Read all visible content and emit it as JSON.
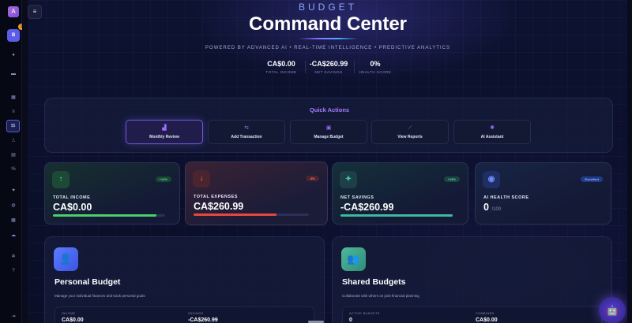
{
  "sidebar": {
    "logo_glyph": "A",
    "avatar_initial": "B",
    "notification_count": "1",
    "icons": [
      {
        "name": "home-icon",
        "glyph": "●"
      },
      {
        "name": "wallet-icon",
        "glyph": "▬"
      },
      {
        "name": "calendar-icon",
        "glyph": "▦"
      },
      {
        "name": "list-icon",
        "glyph": "≡"
      },
      {
        "name": "chart-icon",
        "glyph": "⎍"
      },
      {
        "name": "target-icon",
        "glyph": "◎"
      },
      {
        "name": "document-icon",
        "glyph": "▤"
      },
      {
        "name": "percent-icon",
        "glyph": "%"
      },
      {
        "name": "heart-icon",
        "glyph": "♥"
      },
      {
        "name": "globe-icon",
        "glyph": "◍"
      },
      {
        "name": "grid-icon",
        "glyph": "▦"
      },
      {
        "name": "cloud-icon",
        "glyph": "☁"
      },
      {
        "name": "gear-icon",
        "glyph": "✲"
      },
      {
        "name": "help-icon",
        "glyph": "?"
      },
      {
        "name": "logout-icon",
        "glyph": "⇥"
      }
    ],
    "active_label": "$$"
  },
  "hero": {
    "kicker": "BUDGET",
    "title": "Command Center",
    "subtitle": "POWERED BY ADVANCED AI • REAL-TIME INTELLIGENCE • PREDICTIVE ANALYTICS",
    "stats": [
      {
        "value": "CA$0.00",
        "label": "TOTAL INCOME"
      },
      {
        "value": "-CA$260.99",
        "label": "NET SAVINGS"
      },
      {
        "value": "0%",
        "label": "HEALTH SCORE"
      }
    ]
  },
  "quick_actions": {
    "title": "Quick Actions",
    "buttons": [
      {
        "label": "Monthly Review",
        "icon": "bar-chart-icon",
        "glyph": "▟"
      },
      {
        "label": "Add Transaction",
        "icon": "swap-icon",
        "glyph": "⇆"
      },
      {
        "label": "Manage Budget",
        "icon": "wallet-icon",
        "glyph": "▣"
      },
      {
        "label": "View Reports",
        "icon": "line-chart-icon",
        "glyph": "⟋"
      },
      {
        "label": "AI Assistant",
        "icon": "brain-icon",
        "glyph": "✺"
      }
    ]
  },
  "cards": {
    "income": {
      "label": "TOTAL INCOME",
      "value": "CA$0.00",
      "badge": "+12%",
      "icon_glyph": "↑",
      "progress": 0.92
    },
    "expenses": {
      "label": "TOTAL EXPENSES",
      "value": "CA$260.99",
      "badge": "-8%",
      "icon_glyph": "↓",
      "progress": 0.72
    },
    "savings": {
      "label": "NET SAVINGS",
      "value": "-CA$260.99",
      "badge": "+15%",
      "icon_glyph": "✦",
      "progress": 1.0
    },
    "health": {
      "label": "AI HEALTH SCORE",
      "value": "0",
      "suffix": "/100",
      "badge": "Excellent",
      "icon_glyph": "◉"
    }
  },
  "personal": {
    "title": "Personal Budget",
    "description": "Manage your individual finances and track personal goals",
    "icon_glyph": "👤",
    "stats": [
      {
        "label": "INCOME",
        "value": "CA$0.00"
      },
      {
        "label": "SAVINGS",
        "value": "-CA$260.99"
      }
    ]
  },
  "shared": {
    "title": "Shared Budgets",
    "description": "Collaborate with others on joint financial planning",
    "icon_glyph": "👥",
    "stats": [
      {
        "label": "ACTIVE BUDGETS",
        "value": "0"
      },
      {
        "label": "COMBINED",
        "value": "CA$0.00"
      }
    ]
  },
  "chat": {
    "glyph": "🤖"
  },
  "menu": {
    "glyph": "≡"
  },
  "colors": {
    "accent": "#8c6bff",
    "income": "#4ee08a",
    "expense": "#e8473c",
    "savings": "#3fb8a0",
    "background": "#0b0f24"
  }
}
